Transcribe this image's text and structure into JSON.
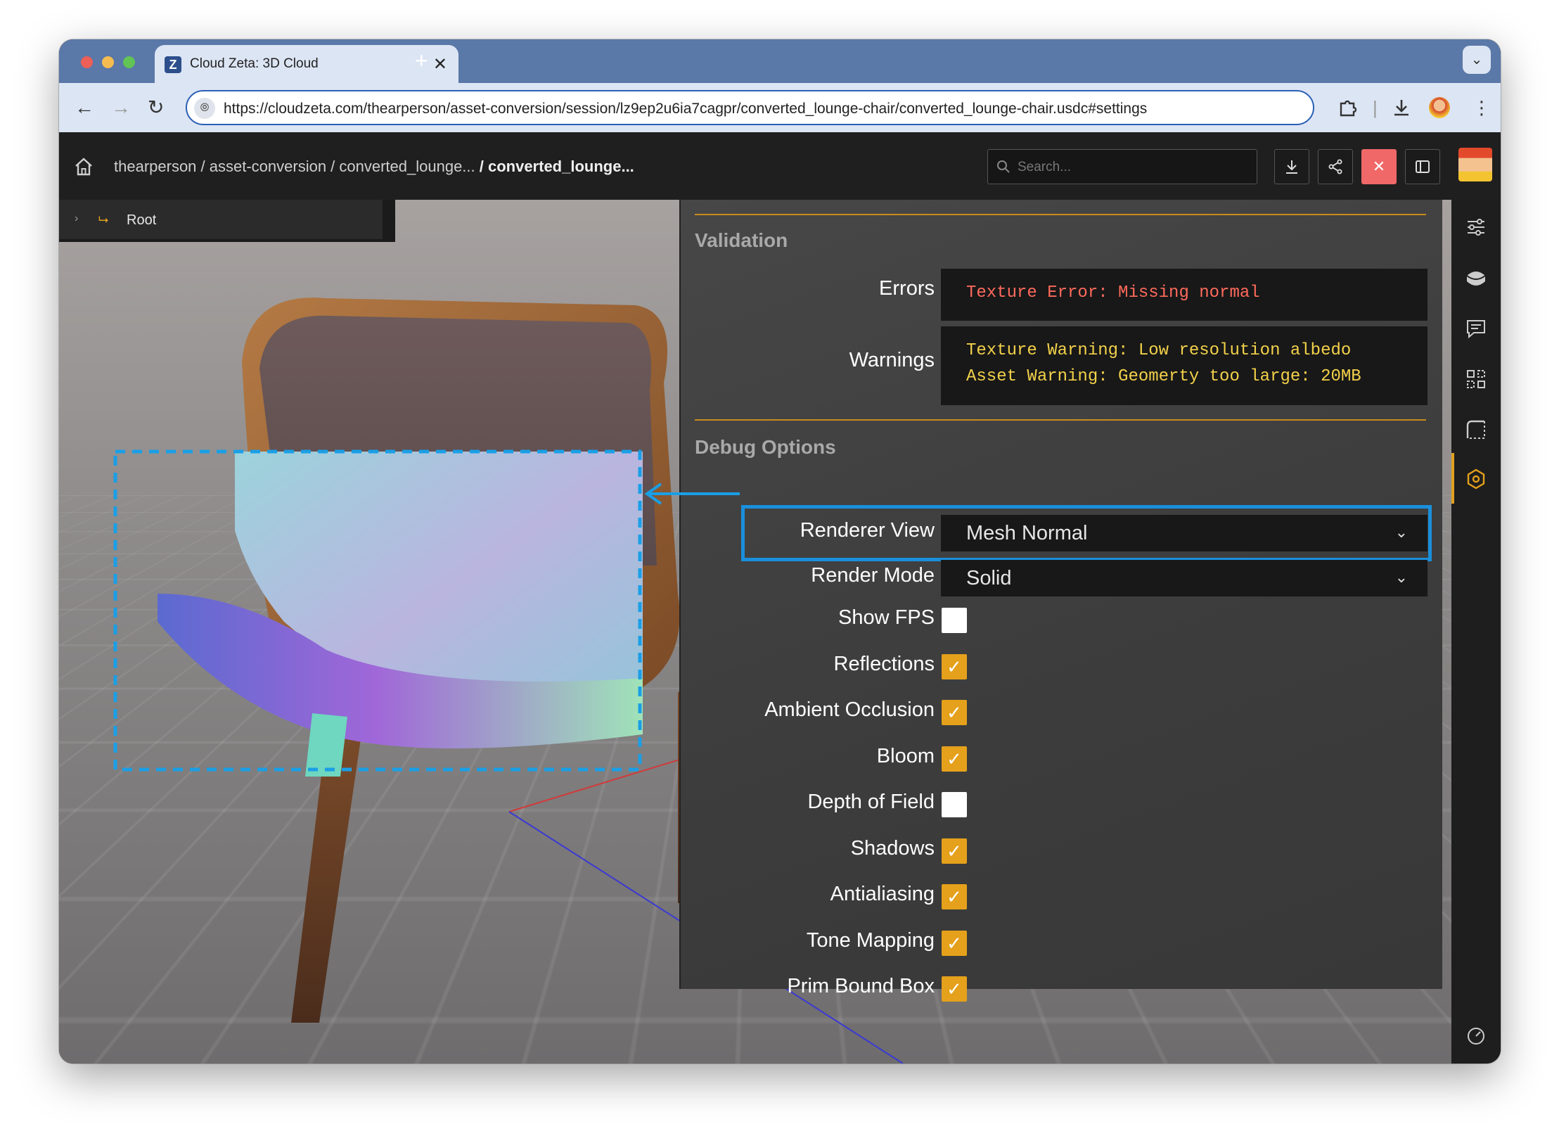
{
  "browser": {
    "tab_title": "Cloud Zeta: 3D Cloud",
    "tab_favicon": "Z",
    "tab_close": "✕",
    "new_tab": "+",
    "url": "https://cloudzeta.com/thearperson/asset-conversion/session/lz9ep2u6ia7cagpr/converted_lounge-chair/converted_lounge-chair.usdc#settings"
  },
  "header": {
    "breadcrumb_path": "thearperson / asset-conversion / converted_lounge... ",
    "breadcrumb_current": "/ converted_lounge...",
    "search_placeholder": "Search..."
  },
  "scene_tree": {
    "root_label": "Root"
  },
  "validation": {
    "title": "Validation",
    "errors_label": "Errors",
    "errors_text": "Texture Error: Missing normal",
    "warnings_label": "Warnings",
    "warnings_text": "Texture Warning: Low resolution albedo\nAsset Warning: Geomerty too large: 20MB"
  },
  "debug": {
    "title": "Debug Options",
    "renderer_view_label": "Renderer View",
    "renderer_view_value": "Mesh Normal",
    "render_mode_label": "Render Mode",
    "render_mode_value": "Solid",
    "options": [
      {
        "label": "Show FPS",
        "checked": false
      },
      {
        "label": "Reflections",
        "checked": true
      },
      {
        "label": "Ambient Occlusion",
        "checked": true
      },
      {
        "label": "Bloom",
        "checked": true
      },
      {
        "label": "Depth of Field",
        "checked": false
      },
      {
        "label": "Shadows",
        "checked": true
      },
      {
        "label": "Antialiasing",
        "checked": true
      },
      {
        "label": "Tone Mapping",
        "checked": true
      },
      {
        "label": "Prim Bound Box",
        "checked": true
      }
    ]
  },
  "colors": {
    "accent": "#e5a11b",
    "error": "#ff6a5c",
    "warning": "#f3d14a",
    "highlight": "#1a8fdc"
  }
}
